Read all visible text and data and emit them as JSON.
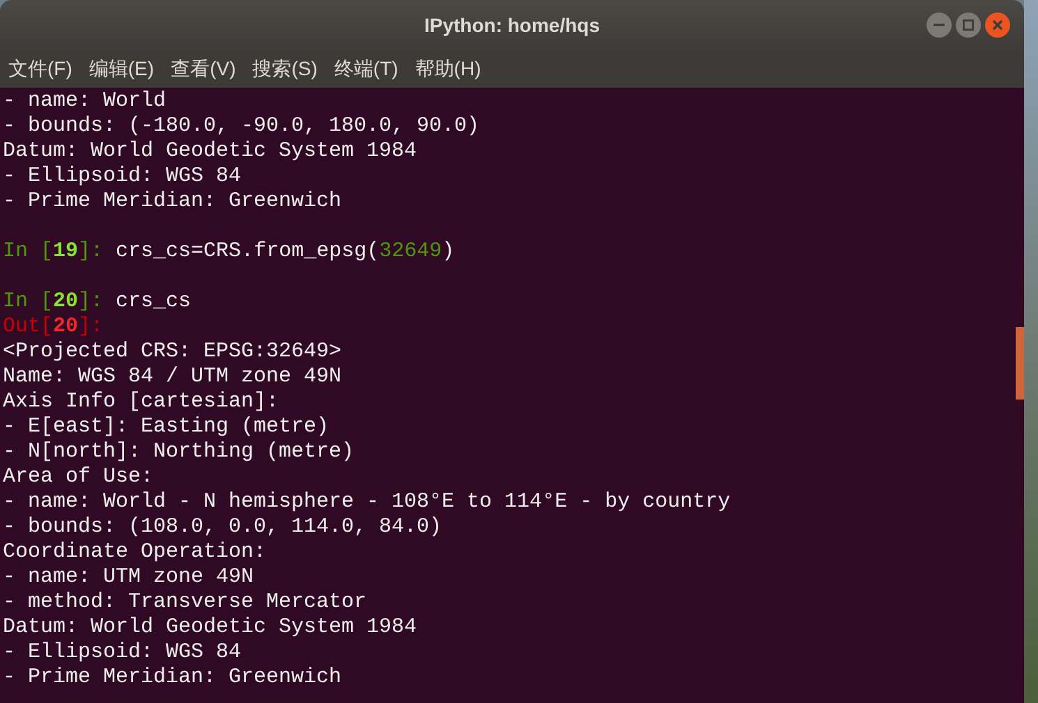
{
  "window": {
    "title": "IPython: home/hqs"
  },
  "menu": [
    "文件(F)",
    "编辑(E)",
    "查看(V)",
    "搜索(S)",
    "终端(T)",
    "帮助(H)"
  ],
  "terminal": {
    "lines": [
      {
        "kind": "text",
        "segments": [
          {
            "kind": "plain",
            "text": "- name: World"
          }
        ]
      },
      {
        "kind": "text",
        "segments": [
          {
            "kind": "plain",
            "text": "- bounds: (-180.0, -90.0, 180.0, 90.0)"
          }
        ]
      },
      {
        "kind": "text",
        "segments": [
          {
            "kind": "plain",
            "text": "Datum: World Geodetic System 1984"
          }
        ]
      },
      {
        "kind": "text",
        "segments": [
          {
            "kind": "plain",
            "text": "- Ellipsoid: WGS 84"
          }
        ]
      },
      {
        "kind": "text",
        "segments": [
          {
            "kind": "plain",
            "text": "- Prime Meridian: Greenwich"
          }
        ]
      },
      {
        "kind": "blank"
      },
      {
        "kind": "text",
        "segments": [
          {
            "kind": "in_prompt",
            "text": "In ["
          },
          {
            "kind": "in_number",
            "text": "19"
          },
          {
            "kind": "in_prompt",
            "text": "]: "
          },
          {
            "kind": "plain",
            "text": "crs_cs=CRS.from_epsg("
          },
          {
            "kind": "literal",
            "text": "32649"
          },
          {
            "kind": "plain",
            "text": ")"
          }
        ]
      },
      {
        "kind": "blank"
      },
      {
        "kind": "text",
        "segments": [
          {
            "kind": "in_prompt",
            "text": "In ["
          },
          {
            "kind": "in_number",
            "text": "20"
          },
          {
            "kind": "in_prompt",
            "text": "]: "
          },
          {
            "kind": "plain",
            "text": "crs_cs"
          }
        ]
      },
      {
        "kind": "text",
        "segments": [
          {
            "kind": "out_prompt",
            "text": "Out["
          },
          {
            "kind": "out_number",
            "text": "20"
          },
          {
            "kind": "out_prompt",
            "text": "]:"
          }
        ]
      },
      {
        "kind": "text",
        "segments": [
          {
            "kind": "plain",
            "text": "<Projected CRS: EPSG:32649>"
          }
        ]
      },
      {
        "kind": "text",
        "segments": [
          {
            "kind": "plain",
            "text": "Name: WGS 84 / UTM zone 49N"
          }
        ]
      },
      {
        "kind": "text",
        "segments": [
          {
            "kind": "plain",
            "text": "Axis Info [cartesian]:"
          }
        ]
      },
      {
        "kind": "text",
        "segments": [
          {
            "kind": "plain",
            "text": "- E[east]: Easting (metre)"
          }
        ]
      },
      {
        "kind": "text",
        "segments": [
          {
            "kind": "plain",
            "text": "- N[north]: Northing (metre)"
          }
        ]
      },
      {
        "kind": "text",
        "segments": [
          {
            "kind": "plain",
            "text": "Area of Use:"
          }
        ]
      },
      {
        "kind": "text",
        "segments": [
          {
            "kind": "plain",
            "text": "- name: World - N hemisphere - 108°E to 114°E - by country"
          }
        ]
      },
      {
        "kind": "text",
        "segments": [
          {
            "kind": "plain",
            "text": "- bounds: (108.0, 0.0, 114.0, 84.0)"
          }
        ]
      },
      {
        "kind": "text",
        "segments": [
          {
            "kind": "plain",
            "text": "Coordinate Operation:"
          }
        ]
      },
      {
        "kind": "text",
        "segments": [
          {
            "kind": "plain",
            "text": "- name: UTM zone 49N"
          }
        ]
      },
      {
        "kind": "text",
        "segments": [
          {
            "kind": "plain",
            "text": "- method: Transverse Mercator"
          }
        ]
      },
      {
        "kind": "text",
        "segments": [
          {
            "kind": "plain",
            "text": "Datum: World Geodetic System 1984"
          }
        ]
      },
      {
        "kind": "text",
        "segments": [
          {
            "kind": "plain",
            "text": "- Ellipsoid: WGS 84"
          }
        ]
      },
      {
        "kind": "text",
        "segments": [
          {
            "kind": "plain",
            "text": "- Prime Meridian: Greenwich"
          }
        ]
      }
    ]
  }
}
